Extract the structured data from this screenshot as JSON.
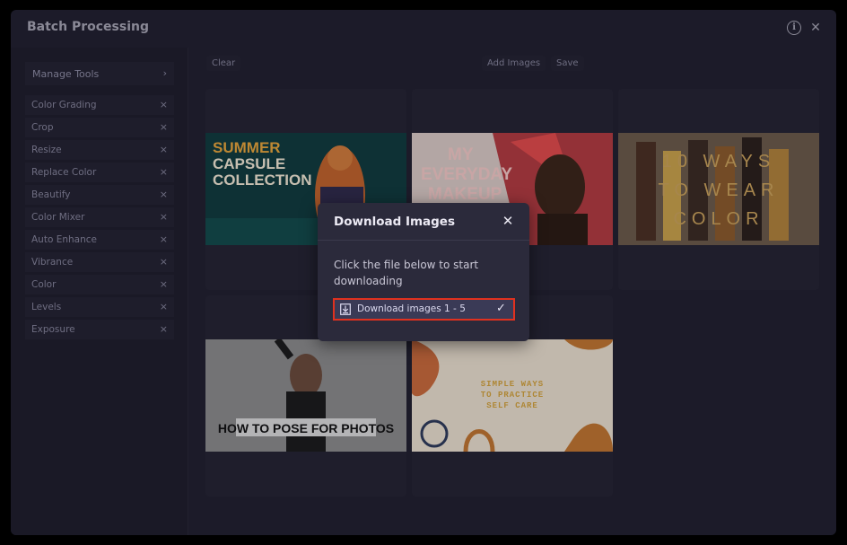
{
  "window": {
    "title": "Batch Processing"
  },
  "header": {
    "info_icon": "info-icon",
    "info_glyph": "i",
    "close_icon": "close-icon",
    "close_glyph": "✕"
  },
  "toolbar": {
    "clear_label": "Clear",
    "add_images_label": "Add Images",
    "save_label": "Save"
  },
  "sidebar": {
    "manage_tools_label": "Manage Tools",
    "manage_chevron": "›",
    "remove_glyph": "×",
    "tools": [
      {
        "label": "Color Grading"
      },
      {
        "label": "Crop"
      },
      {
        "label": "Resize"
      },
      {
        "label": "Replace Color"
      },
      {
        "label": "Beautify"
      },
      {
        "label": "Color Mixer"
      },
      {
        "label": "Auto Enhance"
      },
      {
        "label": "Vibrance"
      },
      {
        "label": "Color"
      },
      {
        "label": "Levels"
      },
      {
        "label": "Exposure"
      }
    ]
  },
  "images": [
    {
      "text_lines": [
        "SUMMER",
        "CAPSULE",
        "COLLECTION"
      ],
      "bg": "#0f3a3c",
      "accent": "#e6a43a"
    },
    {
      "text_lines": [
        "MY",
        "EVERYDAY",
        "MAKEUP"
      ],
      "bg": "#b13a3f",
      "accent": "#f2c7c5"
    },
    {
      "text_lines": [
        "10 WAYS",
        "TO WEAR",
        "COLOR"
      ],
      "bg": "#5c4a3c",
      "accent": "#caa15a"
    },
    {
      "text_lines": [
        "HOW TO POSE FOR PHOTOS"
      ],
      "bg": "#8a8a8a",
      "accent": "#ffffff"
    },
    {
      "text_lines": [
        "SIMPLE WAYS",
        "TO PRACTICE",
        "SELF CARE"
      ],
      "bg": "#eadfcd",
      "accent": "#c0752f"
    }
  ],
  "modal": {
    "title": "Download Images",
    "close_glyph": "✕",
    "message": "Click the file below to start downloading",
    "download_label": "Download images 1 - 5",
    "check_glyph": "✓"
  },
  "colors": {
    "accent_red": "#e0311f",
    "modal_bg": "#2b2a3b",
    "window_bg": "#1c1b29"
  }
}
